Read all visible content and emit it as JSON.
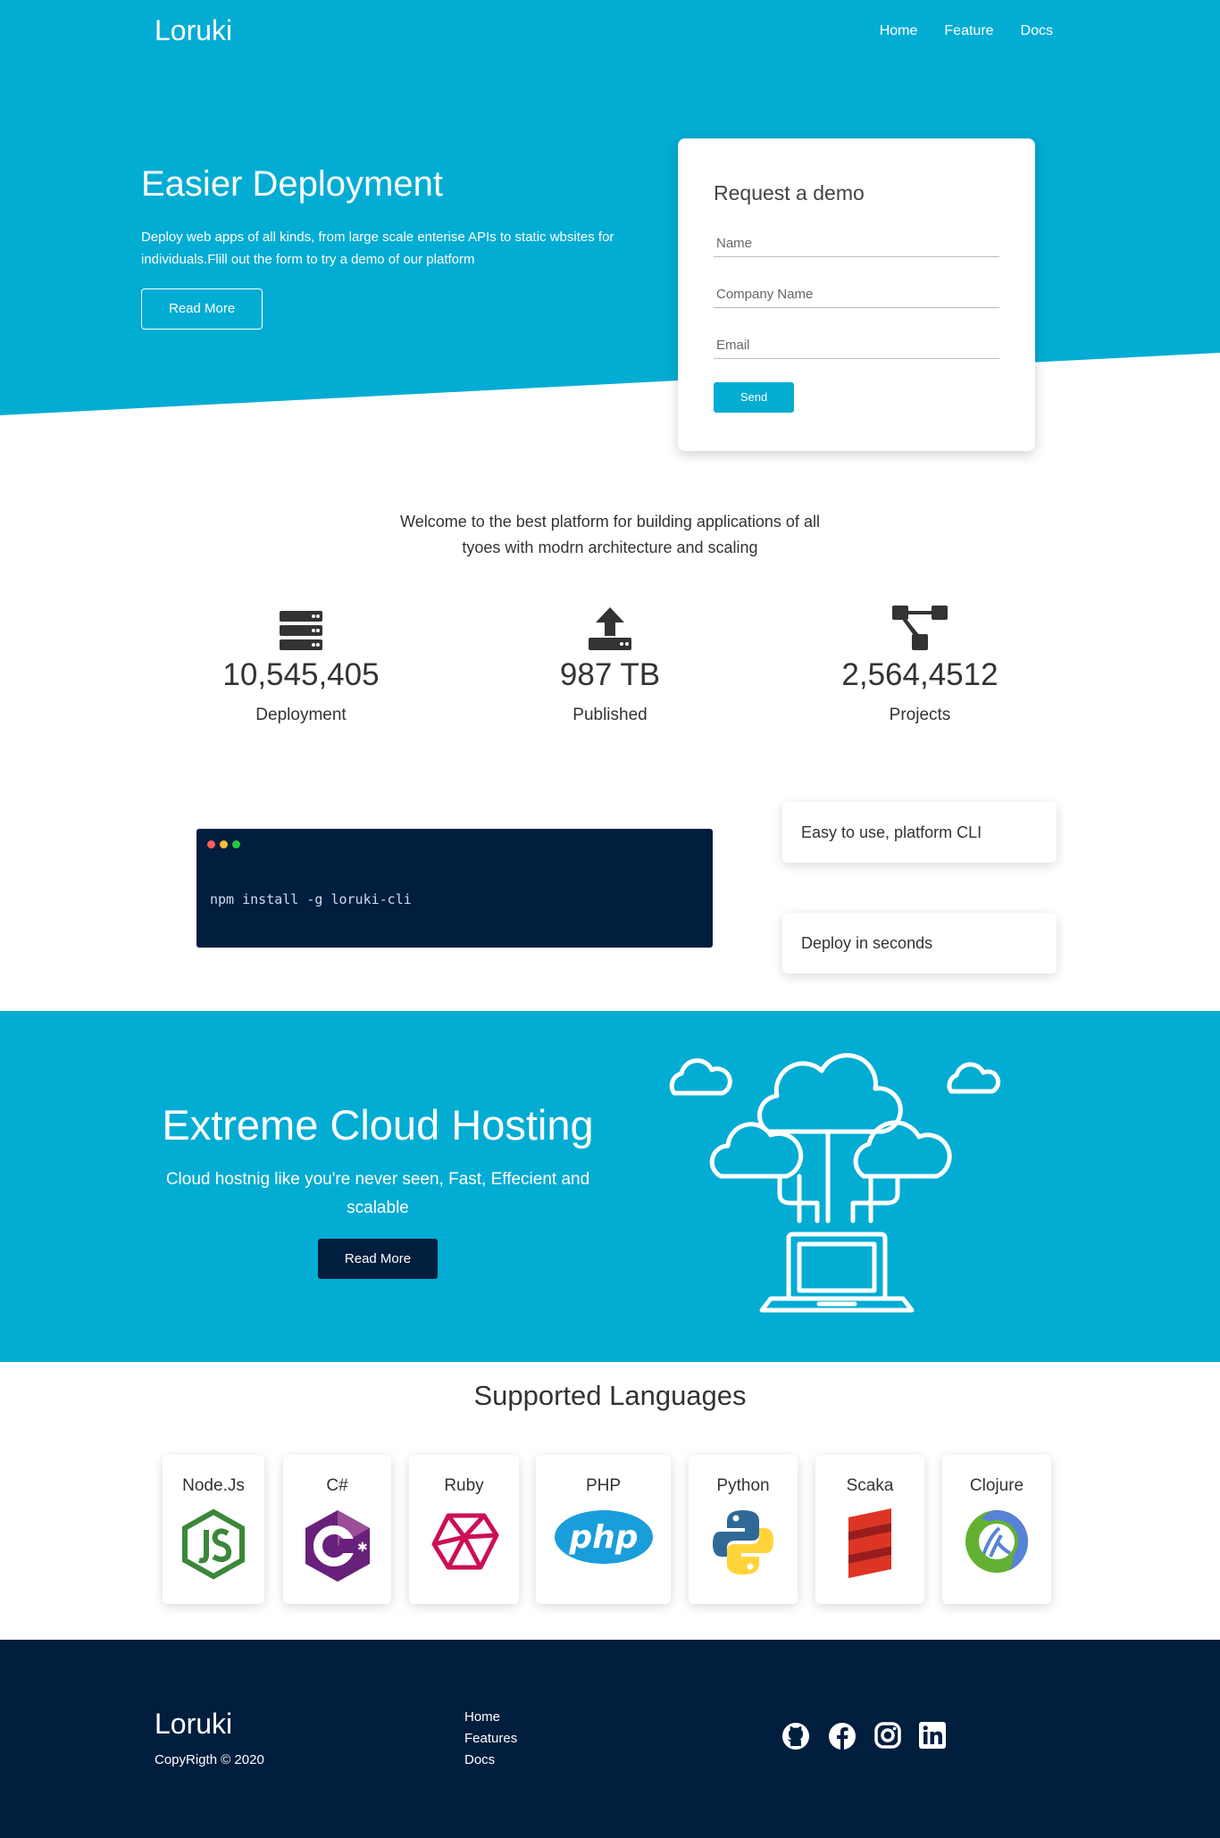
{
  "header": {
    "brand": "Loruki",
    "nav": [
      "Home",
      "Feature",
      "Docs"
    ]
  },
  "hero": {
    "title": "Easier Deployment",
    "description": "Deploy web apps of all kinds, from large scale enterise APIs to static wbsites for individuals.Flill out the form to try a demo of our platform",
    "button": "Read More"
  },
  "demo_form": {
    "title": "Request a demo",
    "fields": [
      "Name",
      "Company Name",
      "Email"
    ],
    "submit": "Send"
  },
  "welcome": "Welcome to the best platform for building applications of all tyoes with modrn architecture and scaling",
  "stats": [
    {
      "icon": "server-icon",
      "value": "10,545,405",
      "label": "Deployment"
    },
    {
      "icon": "upload-icon",
      "value": "987 TB",
      "label": "Published"
    },
    {
      "icon": "project-diagram-icon",
      "value": "2,564,4512",
      "label": "Projects"
    }
  ],
  "cli": {
    "command": "npm install -g loruki-cli",
    "features": [
      "Easy to use, platform CLI",
      "Deploy in seconds"
    ]
  },
  "cloud": {
    "title": "Extreme Cloud Hosting",
    "description": "Cloud hostnig like you're never seen, Fast, Effecient and scalable",
    "button": "Read More"
  },
  "languages": {
    "title": "Supported Languages",
    "items": [
      "Node.Js",
      "C#",
      "Ruby",
      "PHP",
      "Python",
      "Scaka",
      "Clojure"
    ]
  },
  "footer": {
    "brand": "Loruki",
    "copyright": "CopyRigth © 2020",
    "links": [
      "Home",
      "Features",
      "Docs"
    ],
    "social": [
      "github-icon",
      "facebook-icon",
      "instagram-icon",
      "linkedin-icon"
    ]
  },
  "colors": {
    "primary": "#03acd3",
    "dark": "#011e3f"
  }
}
